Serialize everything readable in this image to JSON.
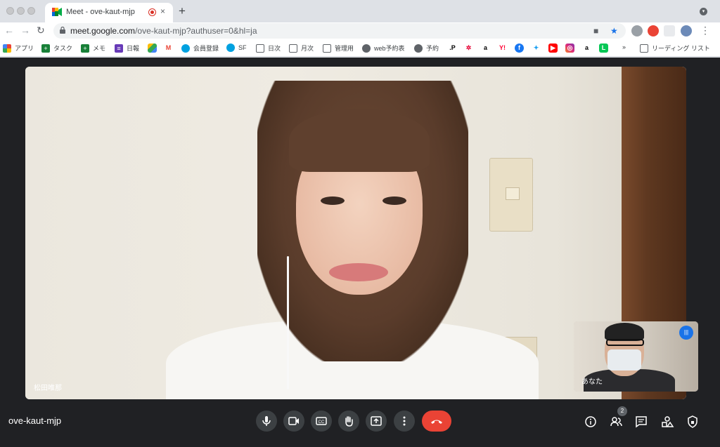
{
  "browser": {
    "tab": {
      "title": "Meet - ove-kaut-mjp",
      "close_label": "×"
    },
    "new_tab_label": "+",
    "url_domain": "meet.google.com",
    "url_path": "/ove-kaut-mjp?authuser=0&hl=ja"
  },
  "bookmarks": {
    "apps": "アプリ",
    "tasks": "タスク",
    "memo": "メモ",
    "daily": "日報",
    "member": "会員登録",
    "sf": "SF",
    "daily2": "日次",
    "monthly": "月次",
    "admin": "管理用",
    "webres": "web予約表",
    "reserve": "予約",
    "more": "»",
    "reading_list": "リーディング リスト"
  },
  "meet": {
    "main_participant": "松田唯那",
    "self_label": "あなた",
    "meeting_code": "ove-kaut-mjp",
    "participant_count": "2"
  },
  "icons": {
    "mic": "mic-icon",
    "camera": "camera-icon",
    "captions": "captions-icon",
    "raise_hand": "raise-hand-icon",
    "present": "present-icon",
    "more": "more-icon",
    "hangup": "hangup-icon",
    "info": "info-icon",
    "people": "people-icon",
    "chat": "chat-icon",
    "activities": "activities-icon",
    "host": "host-controls-icon"
  },
  "colors": {
    "meet_bg": "#202124",
    "hangup_red": "#ea4335",
    "accent_blue": "#1a73e8"
  }
}
